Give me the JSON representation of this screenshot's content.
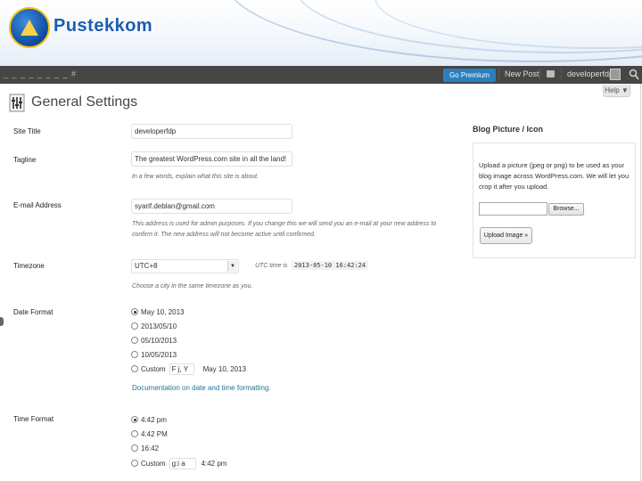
{
  "banner": {
    "brand": "Pustekkom"
  },
  "adminbar": {
    "left_mark": "_ _ _ _ _ _ _ _ #",
    "premium": "Go Premium",
    "new_post": "New Post",
    "user": "developerfdp"
  },
  "help": "Help ▼",
  "page": {
    "title": "General Settings"
  },
  "site_title": {
    "label": "Site Title",
    "value": "developerfdp"
  },
  "tagline": {
    "label": "Tagline",
    "value": "The greatest WordPress.com site in all the land!",
    "desc": "In a few words, explain what this site is about."
  },
  "email": {
    "label": "E-mail Address",
    "value": "syarif.deblan@gmail.com",
    "desc1": "This address is used for admin purposes. If you change this we will send you an e-mail at your new address to",
    "desc2": "confirm it. The new address will not become active until confirmed."
  },
  "timezone": {
    "label": "Timezone",
    "selected": "UTC+8",
    "utc_label": "UTC time is",
    "utc_value": "2013-05-10 16:42:24",
    "desc": "Choose a city in the same timezone as you."
  },
  "date_format": {
    "label": "Date Format",
    "options": [
      "May 10, 2013",
      "2013/05/10",
      "05/10/2013",
      "10/05/2013"
    ],
    "custom_label": "Custom",
    "custom_value": "F j, Y",
    "custom_preview": "May 10, 2013",
    "doc_link": "Documentation on date and time formatting."
  },
  "time_format": {
    "label": "Time Format",
    "options": [
      "4:42 pm",
      "4:42 PM",
      "16:42"
    ],
    "custom_label": "Custom",
    "custom_value": "g:i a",
    "custom_preview": "4:42 pm"
  },
  "blog_picture": {
    "title": "Blog Picture / Icon",
    "text": "Upload a picture (jpeg or png) to be used as your blog image across WordPress.com. We will let you crop it after you upload.",
    "browse": "Browse...",
    "upload": "Upload Image »"
  }
}
